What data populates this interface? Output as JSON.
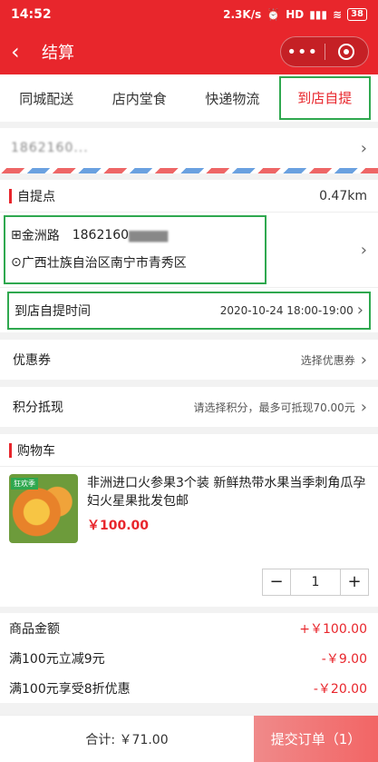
{
  "status": {
    "time": "14:52",
    "speed": "2.3K/s",
    "signal": "HD",
    "battery": "38"
  },
  "nav": {
    "title": "结算"
  },
  "tabs": [
    "同城配送",
    "店内堂食",
    "快递物流",
    "到店自提"
  ],
  "contact": {
    "masked": "1862160..."
  },
  "pickup_point": {
    "title": "自提点",
    "distance": "0.47km",
    "store_name": "金洲路",
    "phone": "1862160",
    "address": "广西壮族自治区南宁市青秀区"
  },
  "pickup_time": {
    "label": "到店自提时间",
    "value": "2020-10-24 18:00-19:00"
  },
  "coupon": {
    "label": "优惠券",
    "value": "选择优惠券"
  },
  "points": {
    "label": "积分抵现",
    "value": "请选择积分，最多可抵现70.00元"
  },
  "cart": {
    "title": "购物车",
    "product_tag": "狂欢季",
    "product_name": "非洲进口火参果3个装 新鲜热带水果当季刺角瓜孕妇火星果批发包邮",
    "product_price": "￥100.00",
    "quantity": "1"
  },
  "summary": [
    {
      "label": "商品金额",
      "value": "+￥100.00"
    },
    {
      "label": "满100元立减9元",
      "value": "-￥9.00"
    },
    {
      "label": "满100元享受8折优惠",
      "value": "-￥20.00"
    }
  ],
  "footer": {
    "total": "合计: ￥71.00",
    "submit": "提交订单（1）"
  },
  "colors": {
    "brand_red": "#e8262c",
    "highlight_green": "#2fa84f"
  }
}
